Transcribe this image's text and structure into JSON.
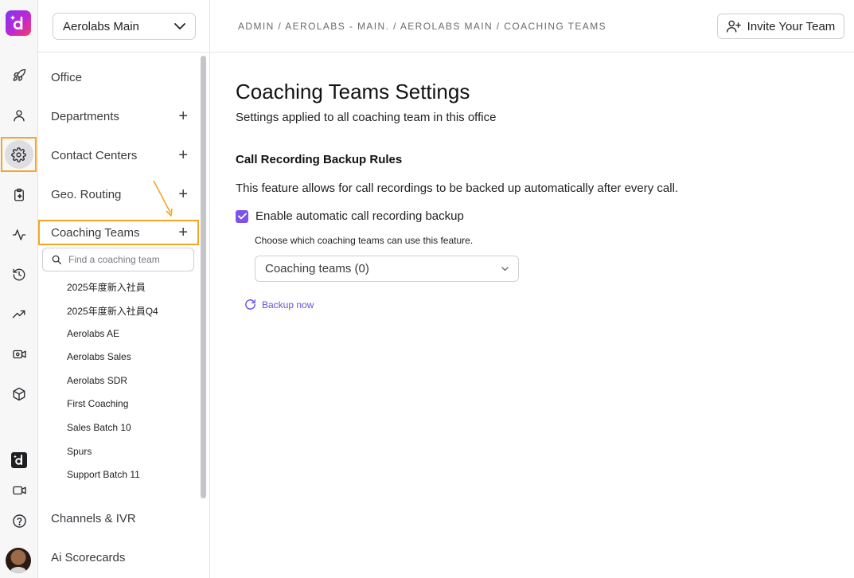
{
  "office_select": {
    "value": "Aerolabs Main"
  },
  "breadcrumb": "ADMIN / AEROLABS - MAIN. / AEROLABS MAIN / COACHING TEAMS",
  "invite_button": "Invite Your Team",
  "nav": {
    "office": "Office",
    "departments": "Departments",
    "contact_centers": "Contact Centers",
    "geo_routing": "Geo. Routing",
    "coaching_teams": "Coaching Teams",
    "channels_ivr": "Channels & IVR",
    "ai_scorecards": "Ai Scorecards"
  },
  "search": {
    "placeholder": "Find a coaching team"
  },
  "teams": [
    "2025年度新入社員",
    "2025年度新入社員Q4",
    "Aerolabs AE",
    "Aerolabs Sales",
    "Aerolabs SDR",
    "First Coaching",
    "Sales Batch 10",
    "Spurs",
    "Support Batch 11"
  ],
  "main": {
    "title": "Coaching Teams Settings",
    "subtitle": "Settings applied to all coaching team in this office",
    "section_title": "Call Recording Backup Rules",
    "description": "This feature allows for call recordings to be backed up automatically after every call.",
    "checkbox_label": "Enable automatic call recording backup",
    "hint": "Choose which coaching teams can use this feature.",
    "dropdown_value": "Coaching teams (0)",
    "backup_now": "Backup now"
  },
  "colors": {
    "accent": "#7c52e8",
    "highlight": "#f5a623"
  }
}
